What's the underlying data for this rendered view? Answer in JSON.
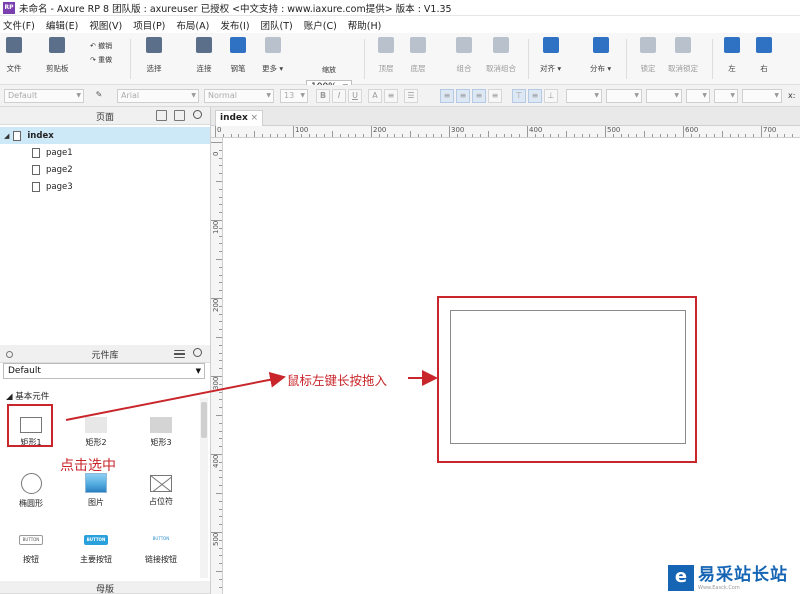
{
  "window": {
    "title": "未命名 - Axure RP 8 团队版 : axureuser 已授权    <中文支持 : www.iaxure.com提供> 版本 : V1.35",
    "logo_text": "RP"
  },
  "menu": [
    "文件(F)",
    "编辑(E)",
    "视图(V)",
    "项目(P)",
    "布局(A)",
    "发布(I)",
    "团队(T)",
    "账户(C)",
    "帮助(H)"
  ],
  "toolbar": {
    "file": "文件",
    "clipboard": "剪贴板",
    "undo": "撤销",
    "redo": "重做",
    "select": "选择",
    "connect": "连接",
    "pen": "钢笔",
    "more": "更多",
    "zoom_value": "100%",
    "zoom_label": "缩放",
    "top": "顶层",
    "bottom": "底层",
    "group": "组合",
    "ungroup": "取消组合",
    "align": "对齐",
    "distribute": "分布",
    "lock": "锁定",
    "unlock": "取消锁定",
    "left": "左",
    "right": "右"
  },
  "formatbar": {
    "style": "Default",
    "font": "Arial",
    "weight": "Normal",
    "size": "13",
    "bold": "B",
    "italic": "I",
    "underline": "U",
    "x_label": "x:"
  },
  "pages_panel": {
    "title": "页面",
    "root": "index",
    "children": [
      "page1",
      "page2",
      "page3"
    ]
  },
  "library_panel": {
    "title": "元件库",
    "selected_library": "Default",
    "category": "基本元件",
    "widgets": [
      {
        "label": "矩形1"
      },
      {
        "label": "矩形2"
      },
      {
        "label": "矩形3"
      },
      {
        "label": "椭圆形"
      },
      {
        "label": "图片"
      },
      {
        "label": "占位符"
      },
      {
        "label": "按钮",
        "preview": "BUTTON"
      },
      {
        "label": "主要按钮",
        "preview": "BUTTON"
      },
      {
        "label": "链接按钮",
        "preview": "BUTTON"
      }
    ]
  },
  "masters_panel": {
    "title": "母版"
  },
  "editor": {
    "tab": "index",
    "ruler_top": [
      "0",
      "100",
      "200",
      "300",
      "400",
      "500",
      "600",
      "700"
    ],
    "ruler_left": [
      "0",
      "100",
      "200",
      "300",
      "400",
      "500"
    ]
  },
  "annotations": {
    "click_select": "点击选中",
    "drag_in": "鼠标左键长按拖入"
  },
  "watermark": {
    "name": "易采站长站",
    "url": "Www.Easck.Com"
  },
  "colors": {
    "annotation_red": "#c8262b",
    "selection_blue": "#cde8f7",
    "watermark_blue": "#1565b4"
  }
}
